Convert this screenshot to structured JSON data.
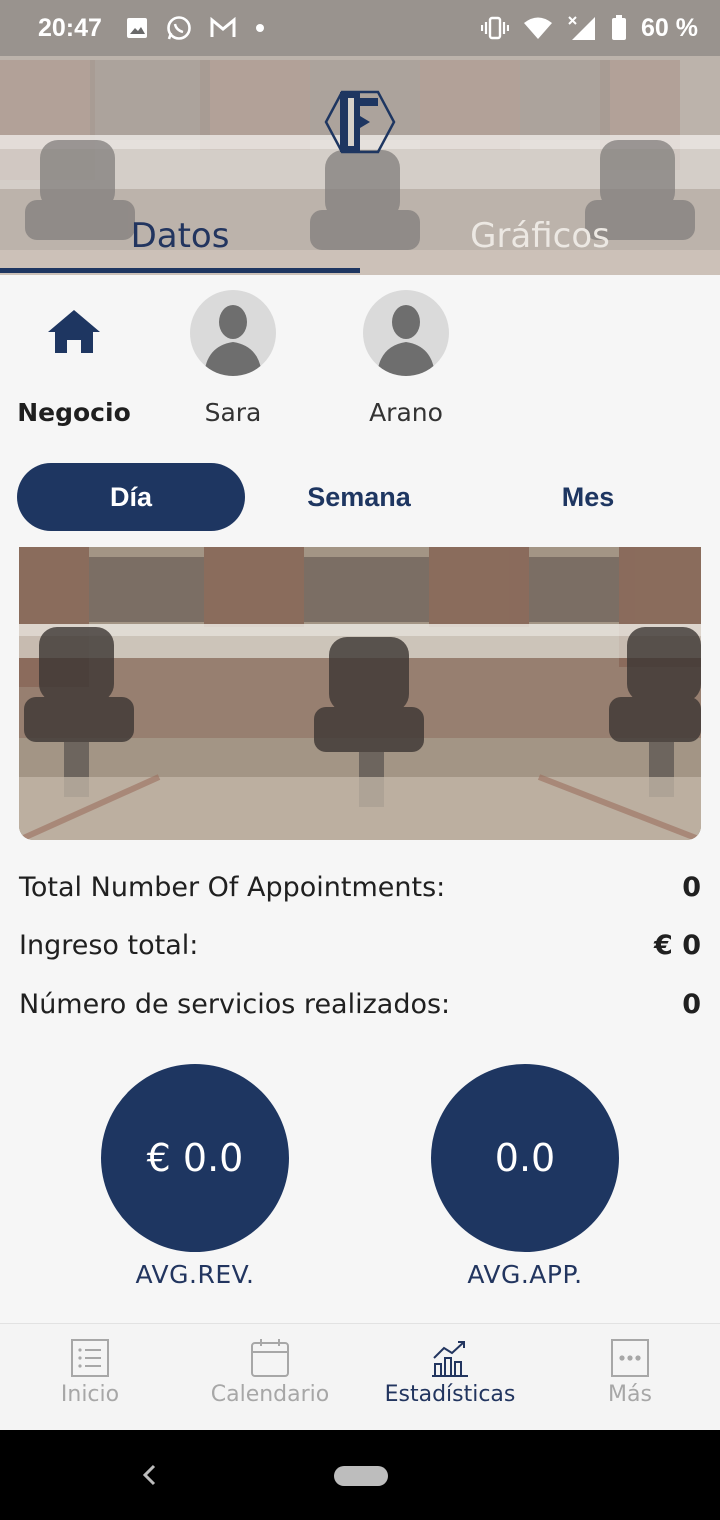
{
  "status_bar": {
    "time": "20:47",
    "battery": "60 %",
    "icons": [
      "image-icon",
      "whatsapp-icon",
      "gmail-icon",
      "dot-icon",
      "vibrate-icon",
      "wifi-icon",
      "signal-icon",
      "battery-icon"
    ]
  },
  "header": {
    "tabs": [
      {
        "label": "Datos",
        "active": true
      },
      {
        "label": "Gráficos",
        "active": false
      }
    ]
  },
  "staff": [
    {
      "label": "Negocio",
      "icon": "home-icon",
      "selected": true
    },
    {
      "label": "Sara",
      "icon": "person-avatar-icon",
      "selected": false
    },
    {
      "label": "Arano",
      "icon": "person-avatar-icon",
      "selected": false
    }
  ],
  "period": {
    "options": [
      "Día",
      "Semana",
      "Mes"
    ],
    "selected": "Día"
  },
  "stats": [
    {
      "label": "Total Number Of Appointments:",
      "value": "0"
    },
    {
      "label": "Ingreso total:",
      "value": "€ 0"
    },
    {
      "label": "Número de servicios realizados:",
      "value": "0"
    }
  ],
  "averages": [
    {
      "value": "€ 0.0",
      "label": "AVG.REV."
    },
    {
      "value": "0.0",
      "label": "AVG.APP."
    }
  ],
  "bottom_nav": [
    {
      "label": "Inicio",
      "icon": "list-icon",
      "active": false
    },
    {
      "label": "Calendario",
      "icon": "calendar-icon",
      "active": false
    },
    {
      "label": "Estadísticas",
      "icon": "chart-icon",
      "active": true
    },
    {
      "label": "Más",
      "icon": "more-icon",
      "active": false
    }
  ],
  "colors": {
    "primary": "#1e3661",
    "background": "#f6f6f6",
    "inactive": "#a7a7a7"
  }
}
